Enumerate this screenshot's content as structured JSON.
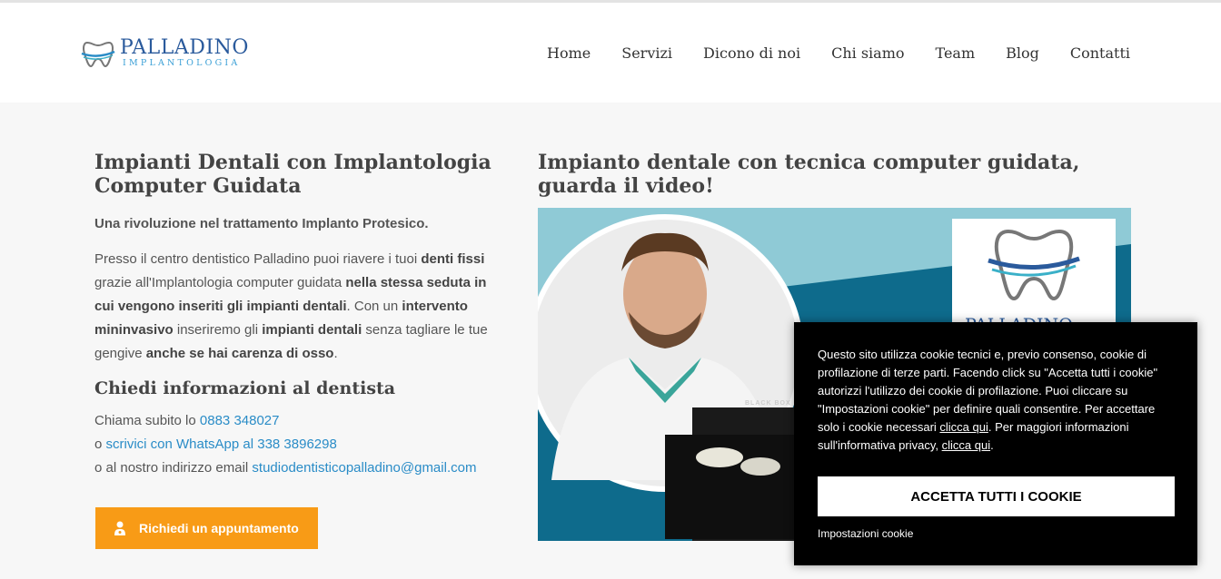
{
  "header": {
    "logo_name": "PALLADINO",
    "logo_sub": "IMPLANTOLOGIA",
    "nav": [
      "Home",
      "Servizi",
      "Dicono di noi",
      "Chi siamo",
      "Team",
      "Blog",
      "Contatti"
    ]
  },
  "left": {
    "title": "Impianti Dentali con Implantologia Computer Guidata",
    "lead": "Una rivoluzione nel trattamento Implanto Protesico.",
    "para": [
      {
        "t": "Presso il centro dentistico Palladino puoi riavere i tuoi ",
        "b": false
      },
      {
        "t": "denti fissi",
        "b": true
      },
      {
        "t": " grazie all'Implantologia computer guidata ",
        "b": false
      },
      {
        "t": "nella stessa seduta in cui vengono inseriti gli impianti dentali",
        "b": true
      },
      {
        "t": ". Con un ",
        "b": false
      },
      {
        "t": "intervento mininvasivo",
        "b": true
      },
      {
        "t": " inseriremo gli ",
        "b": false
      },
      {
        "t": "impianti dentali",
        "b": true
      },
      {
        "t": " senza tagliare le tue gengive ",
        "b": false
      },
      {
        "t": "anche se hai carenza di osso",
        "b": true
      },
      {
        "t": ".",
        "b": false
      }
    ],
    "subtitle": "Chiedi informazioni al dentista",
    "contact": {
      "call_prefix": "Chiama subito lo ",
      "phone": "0883 348027",
      "wa_prefix": "o ",
      "wa_link": "scrivici con WhatsApp al 338 3896298",
      "email_prefix": "o al nostro indirizzo email ",
      "email": "studiodentisticopalladino@gmail.com"
    },
    "cta": "Richiedi un appuntamento"
  },
  "right": {
    "title": "Impianto dentale con tecnica computer guidata, guarda il video!",
    "video_logo": "PALLADINO",
    "box_label": "BLACK BOX"
  },
  "cookie": {
    "msg": [
      {
        "t": "Questo sito utilizza cookie tecnici e, previo consenso, cookie di profilazione di terze parti. Facendo click su \"Accetta tutti i cookie\" autorizzi l'utilizzo dei cookie di profilazione. Puoi cliccare su \"Impostazioni cookie\" per definire quali consentire. Per accettare solo i cookie necessari ",
        "link": false
      },
      {
        "t": "clicca qui",
        "link": true
      },
      {
        "t": ". Per maggiori informazioni sull'informativa privacy, ",
        "link": false
      },
      {
        "t": "clicca qui",
        "link": true
      },
      {
        "t": ".",
        "link": false
      }
    ],
    "accept": "ACCETTA TUTTI I COOKIE",
    "settings": "Impostazioni cookie"
  },
  "colors": {
    "accent": "#f89b16",
    "link": "#2a8cc7",
    "brand": "#2a5a9c",
    "video_bg": "#8fcad6",
    "video_dark": "#0e6b8c"
  }
}
